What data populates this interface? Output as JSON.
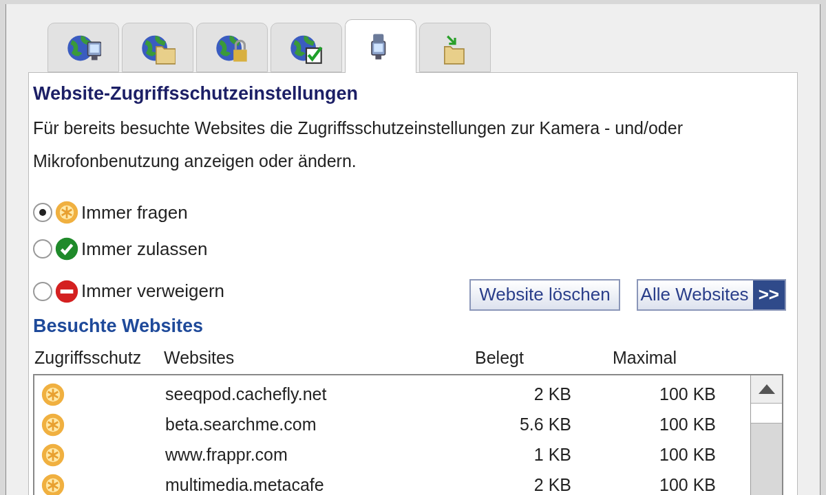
{
  "tabs": [
    {
      "kind": "globe-monitor",
      "selected": false
    },
    {
      "kind": "globe-folder",
      "selected": false
    },
    {
      "kind": "globe-lock",
      "selected": false
    },
    {
      "kind": "globe-check",
      "selected": false
    },
    {
      "kind": "monitor",
      "selected": true
    },
    {
      "kind": "folder",
      "selected": false
    }
  ],
  "heading": "Website-Zugriffsschutzeinstellungen",
  "description": "Für bereits besuchte Websites die Zugriffsschutzeinstellungen zur Kamera - und/oder Mikrofonbenutzung anzeigen oder ändern.",
  "options": [
    {
      "label": "Immer fragen",
      "kind": "ask",
      "selected": true
    },
    {
      "label": "Immer zulassen",
      "kind": "allow",
      "selected": false
    },
    {
      "label": "Immer verweigern",
      "kind": "deny",
      "selected": false
    }
  ],
  "buttons": {
    "delete": "Website löschen",
    "all": "Alle Websites",
    "all_arrow": ">>"
  },
  "list_title": "Besuchte Websites",
  "columns": [
    "Zugriffsschutz",
    "Websites",
    "Belegt",
    "Maximal"
  ],
  "rows": [
    {
      "kind": "ask",
      "site": "seeqpod.cachefly.net",
      "used": "2 KB",
      "max": "100 KB"
    },
    {
      "kind": "ask",
      "site": "beta.searchme.com",
      "used": "5.6 KB",
      "max": "100 KB"
    },
    {
      "kind": "ask",
      "site": "www.frappr.com",
      "used": "1 KB",
      "max": "100 KB"
    },
    {
      "kind": "ask",
      "site": "multimedia.metacafe",
      "used": "2 KB",
      "max": "100 KB"
    }
  ]
}
